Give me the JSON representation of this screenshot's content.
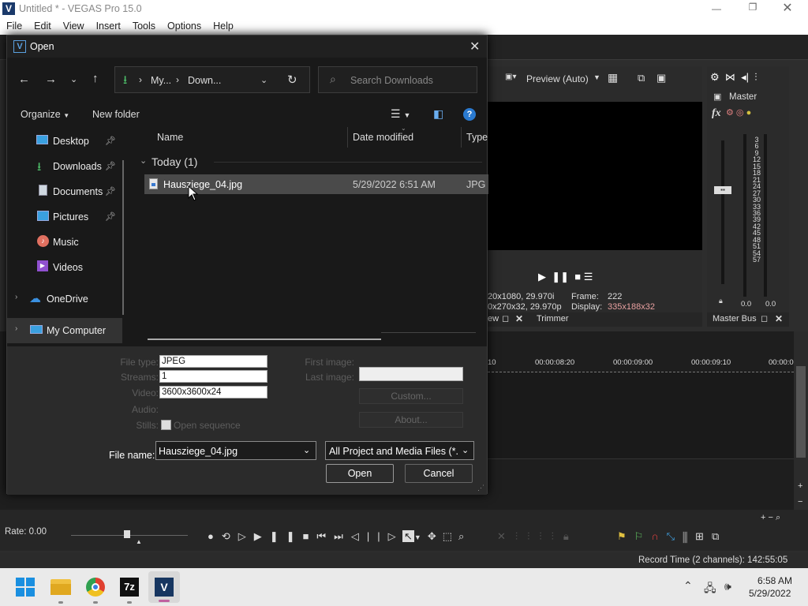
{
  "app": {
    "title": "Untitled * - VEGAS Pro 15.0",
    "menu": [
      "File",
      "Edit",
      "View",
      "Insert",
      "Tools",
      "Options",
      "Help"
    ]
  },
  "preview": {
    "label": "Preview (Auto)",
    "frame_label": "Frame:",
    "frame_value": "222",
    "display_label": "Display:",
    "display_value": "335x188x32",
    "info_line1": "20x1080, 29.970i",
    "info_line2": "0x270x32, 29.970p",
    "tab_trimmer": "Trimmer",
    "tab_prefix": "ew"
  },
  "mixer": {
    "master": "Master",
    "master_bus": "Master Bus",
    "meter_scale": [
      "3",
      "6",
      "9",
      "12",
      "15",
      "18",
      "21",
      "24",
      "27",
      "30",
      "33",
      "36",
      "39",
      "42",
      "45",
      "48",
      "51",
      "54",
      "57"
    ],
    "left_val": "0.0",
    "right_val": "0.0",
    "fx_label": "fx"
  },
  "timeline": {
    "ticks": [
      "10",
      "00:00:08:20",
      "00:00:09:00",
      "00:00:09:10",
      "00:00:0"
    ],
    "rate": "Rate: 0.00",
    "record_time": "Record Time (2 channels): 142:55:05"
  },
  "dialog": {
    "title": "Open",
    "path": [
      "My...",
      "Down..."
    ],
    "search_placeholder": "Search Downloads",
    "organize": "Organize",
    "new_folder": "New folder",
    "nav": [
      {
        "label": "Desktop",
        "icon": "desktop-icon",
        "pinned": true
      },
      {
        "label": "Downloads",
        "icon": "download-icon",
        "pinned": true
      },
      {
        "label": "Documents",
        "icon": "documents-icon",
        "pinned": true
      },
      {
        "label": "Pictures",
        "icon": "pictures-icon",
        "pinned": true
      },
      {
        "label": "Music",
        "icon": "music-icon",
        "pinned": false
      },
      {
        "label": "Videos",
        "icon": "videos-icon",
        "pinned": false
      },
      {
        "label": "OneDrive",
        "icon": "cloud-icon",
        "pinned": false
      },
      {
        "label": "My Computer",
        "icon": "computer-icon",
        "pinned": false
      }
    ],
    "columns": {
      "name": "Name",
      "date": "Date modified",
      "type": "Type"
    },
    "group": "Today (1)",
    "files": [
      {
        "name": "Hausziege_04.jpg",
        "date": "5/29/2022 6:51 AM",
        "type": "JPG F"
      }
    ],
    "props": {
      "file_type_label": "File type:",
      "file_type": "JPEG",
      "streams_label": "Streams:",
      "streams": "1",
      "video_label": "Video:",
      "video": "3600x3600x24",
      "audio_label": "Audio:",
      "stills_label": "Stills:",
      "open_sequence": "Open sequence",
      "first_image_label": "First image:",
      "last_image_label": "Last image:",
      "custom": "Custom...",
      "about": "About..."
    },
    "file_name_label": "File name:",
    "file_name": "Hausziege_04.jpg",
    "filter": "All Project and Media Files (*.ve",
    "open_btn": "Open",
    "cancel_btn": "Cancel"
  },
  "taskbar": {
    "time": "6:58 AM",
    "date": "5/29/2022",
    "apps": [
      "start-icon",
      "file-explorer-icon",
      "chrome-icon",
      "7zip-icon",
      "vegas-icon"
    ],
    "sevenzip_text": "7z",
    "vegas_text": "V"
  }
}
